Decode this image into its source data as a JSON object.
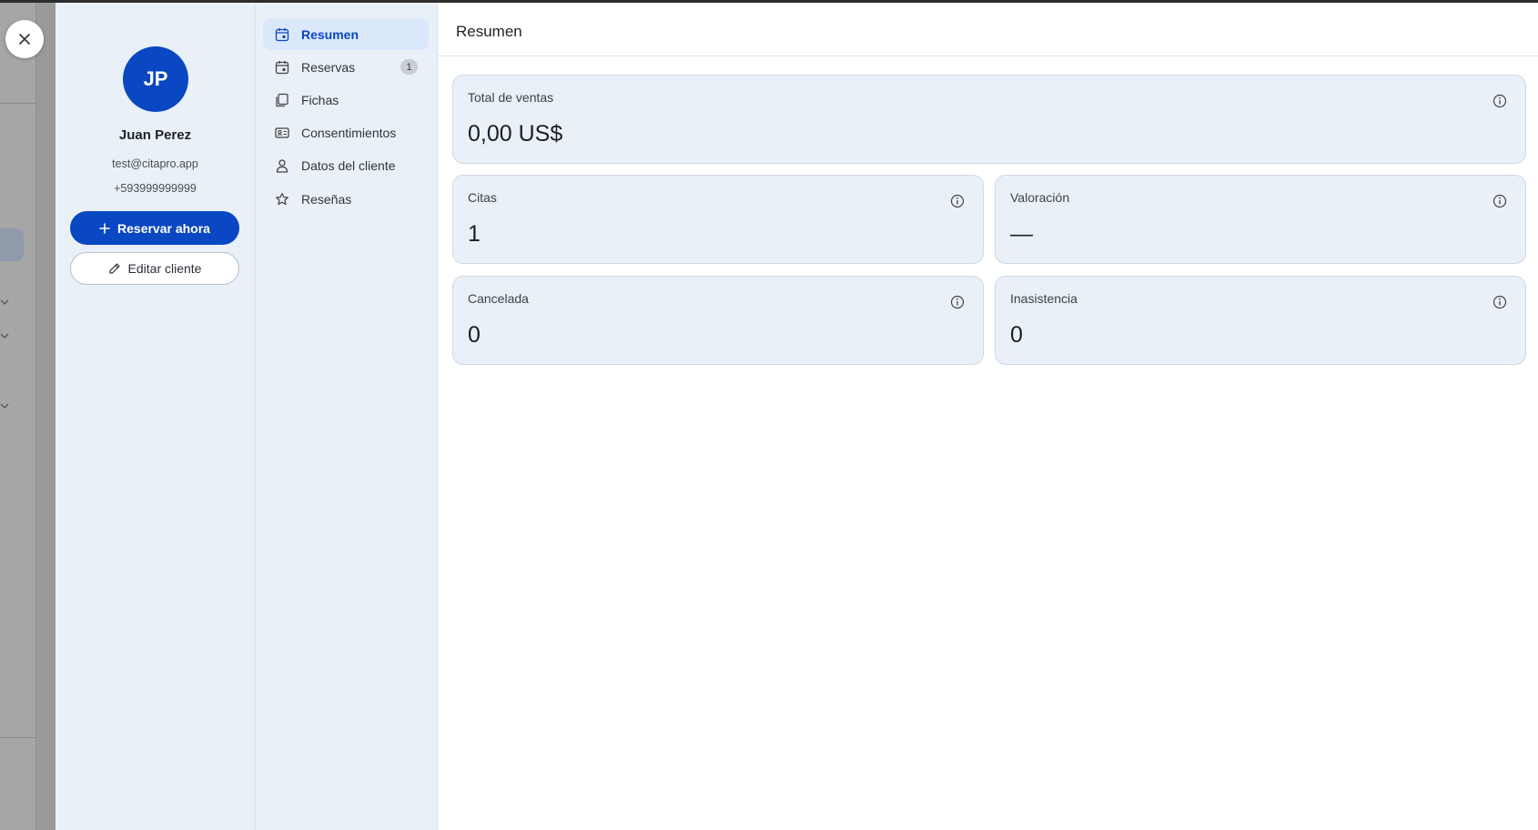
{
  "profile": {
    "initials": "JP",
    "name": "Juan Perez",
    "email": "test@citapro.app",
    "phone": "+593999999999",
    "book_button": "Reservar ahora",
    "edit_button": "Editar cliente"
  },
  "nav": {
    "items": [
      {
        "label": "Resumen",
        "icon": "calendar-icon",
        "active": true
      },
      {
        "label": "Reservas",
        "icon": "calendar-icon",
        "badge": "1"
      },
      {
        "label": "Fichas",
        "icon": "documents-icon"
      },
      {
        "label": "Consentimientos",
        "icon": "id-card-icon"
      },
      {
        "label": "Datos del cliente",
        "icon": "person-icon"
      },
      {
        "label": "Reseñas",
        "icon": "star-icon"
      }
    ]
  },
  "main": {
    "title": "Resumen",
    "cards": {
      "sales": {
        "label": "Total de ventas",
        "value": "0,00 US$"
      },
      "appointments": {
        "label": "Citas",
        "value": "1"
      },
      "rating": {
        "label": "Valoración",
        "value": "—"
      },
      "cancelled": {
        "label": "Cancelada",
        "value": "0"
      },
      "no_show": {
        "label": "Inasistencia",
        "value": "0"
      }
    }
  },
  "colors": {
    "accent": "#0a47c2",
    "panel": "#eaf0f7",
    "active_nav": "#dbe8fb"
  }
}
